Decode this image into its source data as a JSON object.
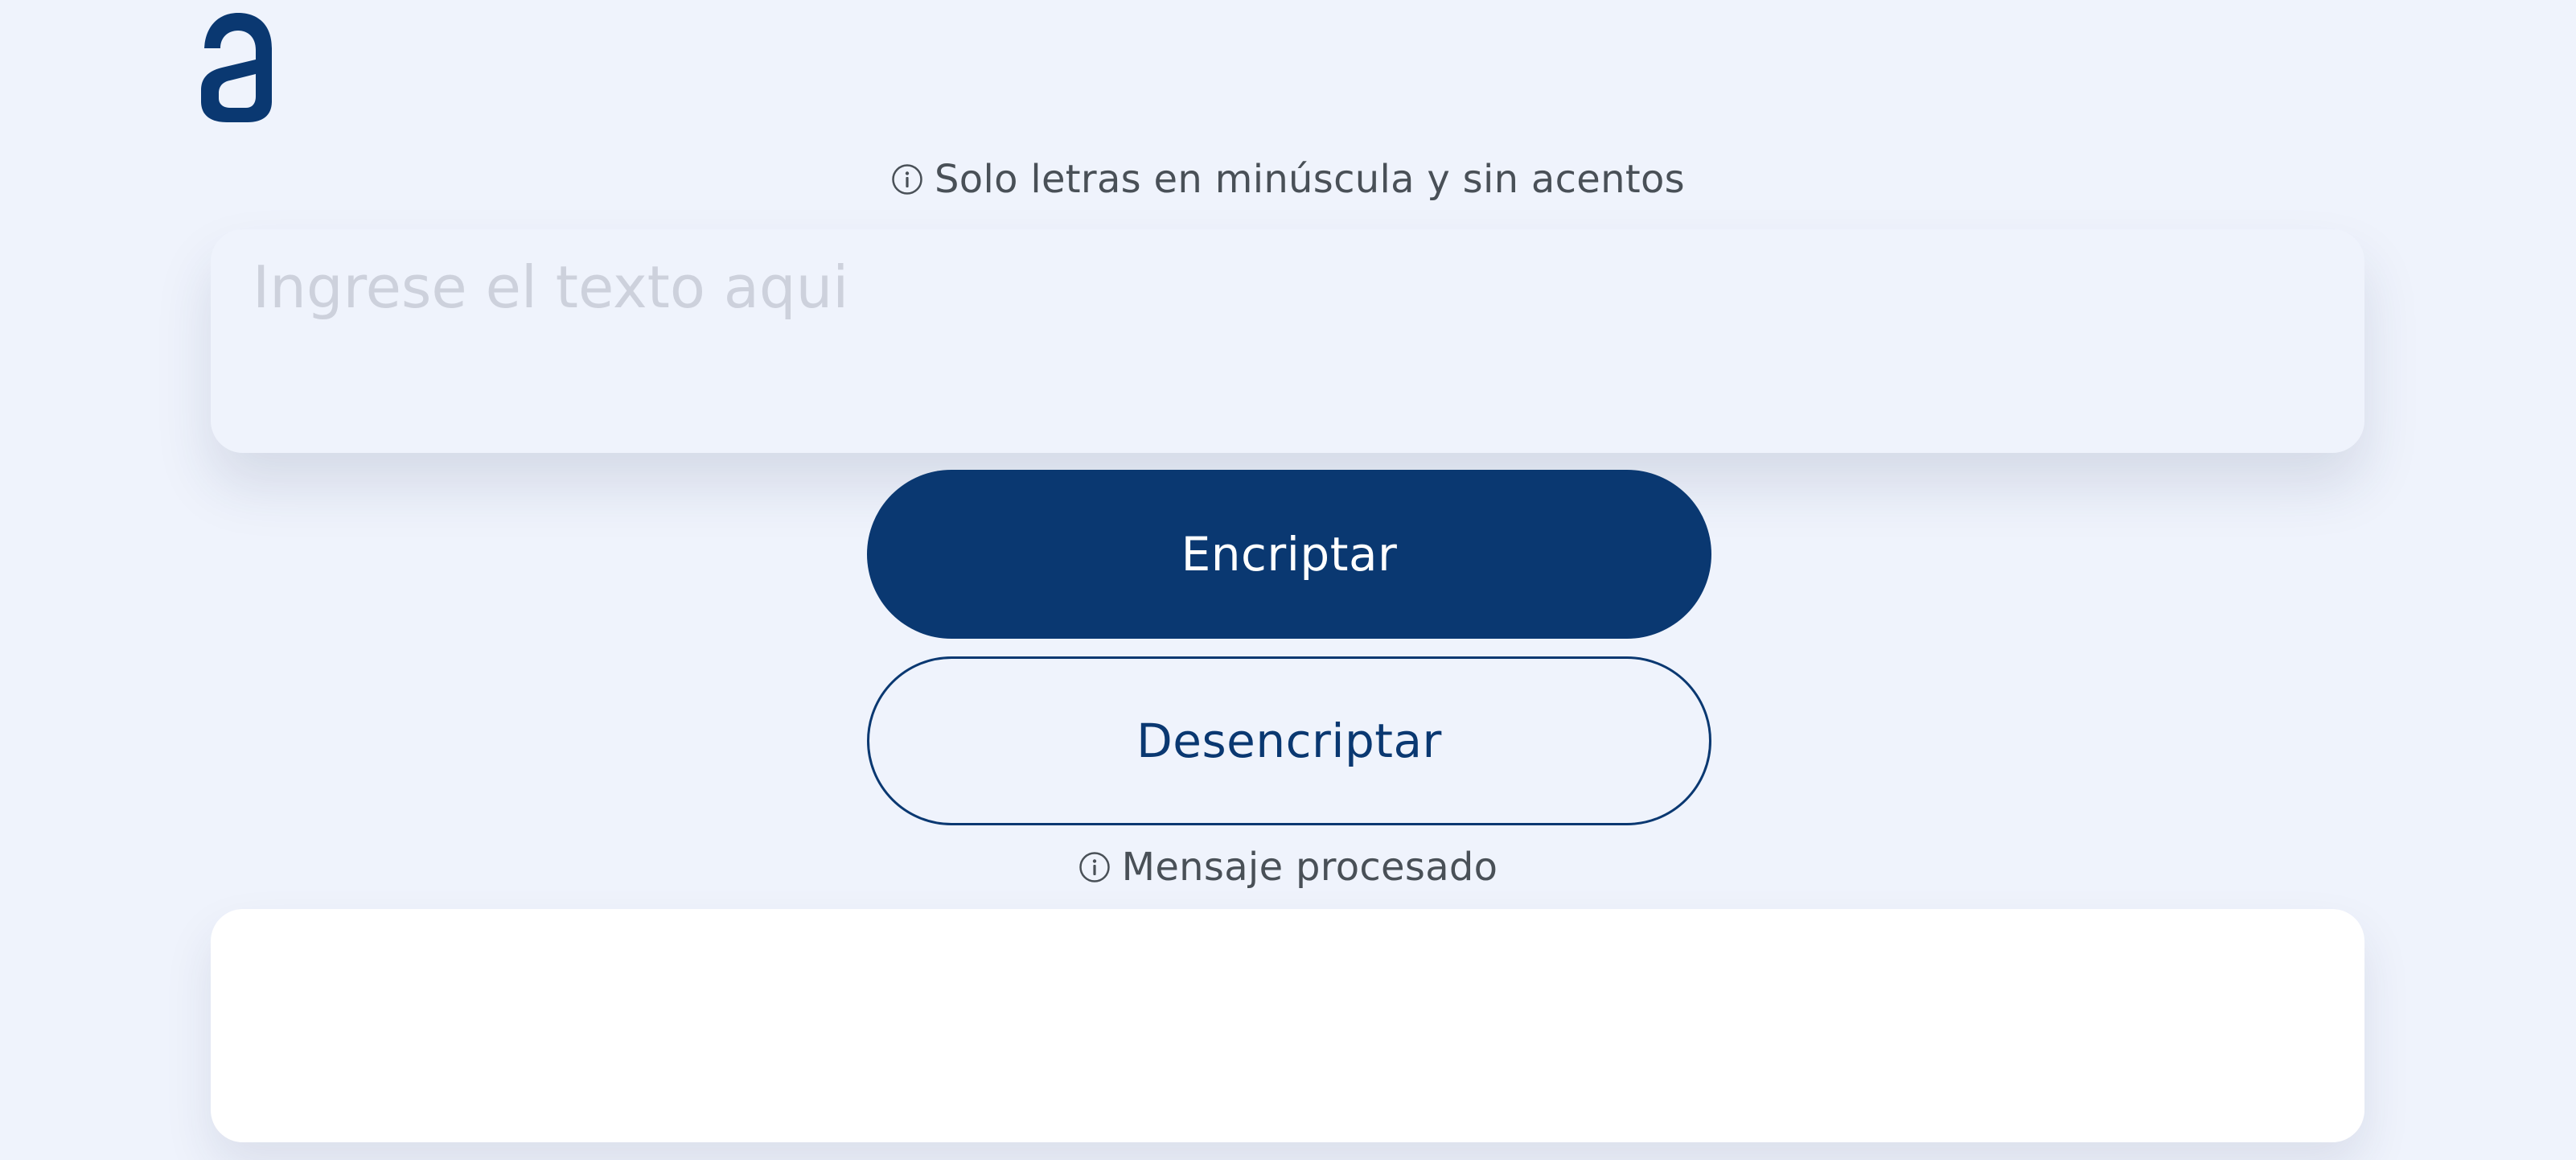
{
  "brand": {
    "logo_letter": "a",
    "accent_color": "#0a3871"
  },
  "input_section": {
    "hint_icon": "info-icon",
    "hint_text": "Solo letras en minúscula y sin acentos",
    "placeholder": "Ingrese el texto aqui",
    "value": ""
  },
  "buttons": {
    "encrypt_label": "Encriptar",
    "decrypt_label": "Desencriptar"
  },
  "output_section": {
    "hint_icon": "info-icon",
    "label": "Mensaje procesado",
    "value": ""
  }
}
